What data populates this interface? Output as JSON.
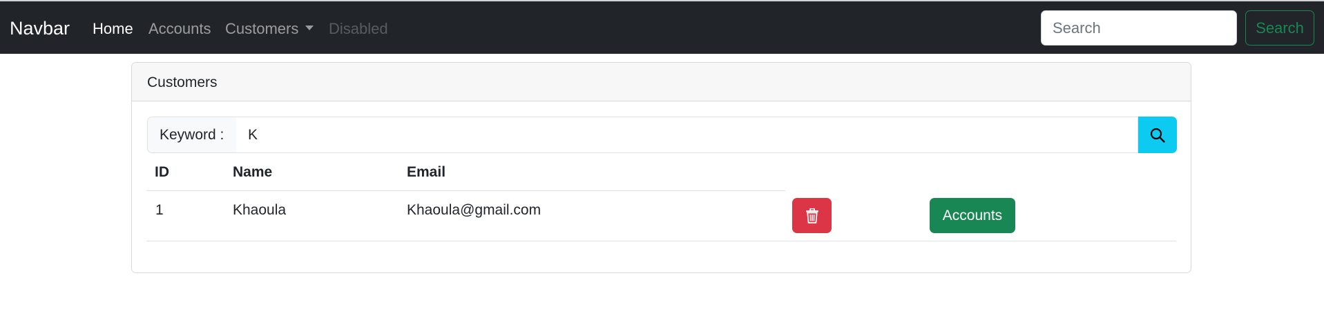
{
  "navbar": {
    "brand": "Navbar",
    "links": [
      {
        "label": "Home"
      },
      {
        "label": "Accounts"
      },
      {
        "label": "Customers"
      },
      {
        "label": "Disabled"
      }
    ],
    "search_placeholder": "Search",
    "search_button": "Search"
  },
  "card": {
    "title": "Customers",
    "search": {
      "label": "Keyword :",
      "value": "K",
      "button_icon": "search-icon"
    },
    "table": {
      "headers": [
        "ID",
        "Name",
        "Email"
      ],
      "rows": [
        {
          "id": "1",
          "name": "Khaoula",
          "email": "Khaoula@gmail.com",
          "delete_icon": "trash-icon",
          "accounts_label": "Accounts"
        }
      ]
    }
  },
  "colors": {
    "navbar_bg": "#212529",
    "success": "#198754",
    "danger": "#dc3545",
    "info": "#0dcaf0"
  }
}
